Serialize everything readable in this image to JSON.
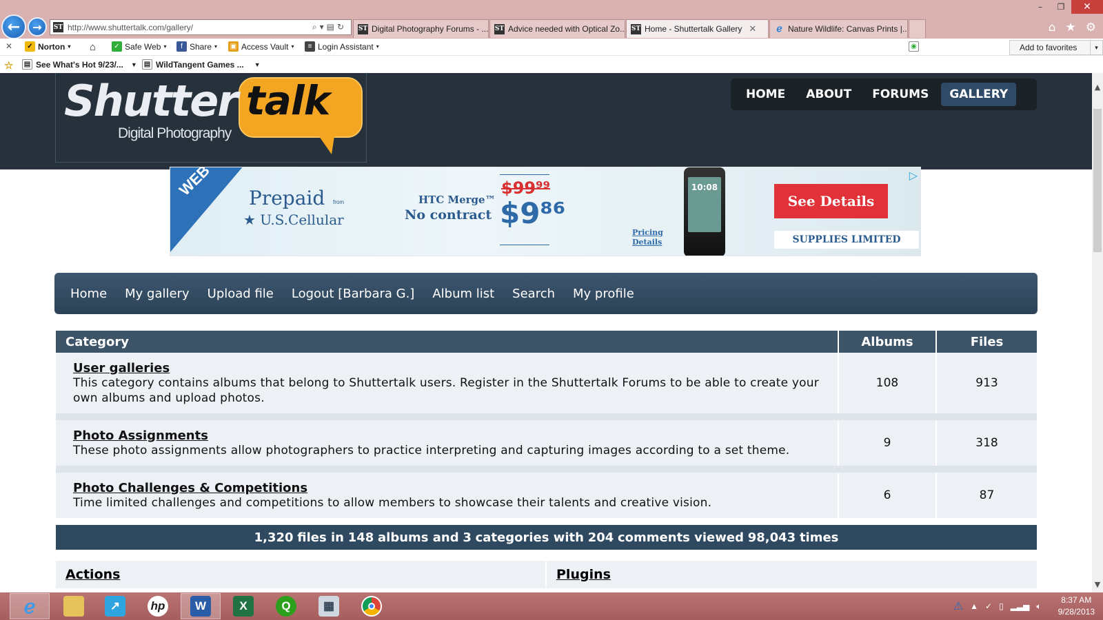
{
  "browser": {
    "url": "http://www.shuttertalk.com/gallery/",
    "tabs": [
      {
        "label": "Digital Photography Forums - ...",
        "active": false,
        "icon": "st-favicon"
      },
      {
        "label": "Advice needed with Optical Zo...",
        "active": false,
        "icon": "st-favicon"
      },
      {
        "label": "Home - Shuttertalk Gallery",
        "active": true,
        "icon": "st-favicon"
      },
      {
        "label": "Nature Wildlife: Canvas Prints |...",
        "active": false,
        "icon": "ie-favicon"
      }
    ],
    "favicon_text": "ST",
    "toolbar": {
      "norton": "Norton",
      "safe_web": "Safe Web",
      "share": "Share",
      "access_vault": "Access Vault",
      "login_assistant": "Login Assistant",
      "add_favorites": "Add to favorites"
    },
    "favorites_bar": {
      "item1": "See What's Hot 9/23/...",
      "item2": "WildTangent Games ..."
    }
  },
  "site": {
    "logo": {
      "word1": "Shutter",
      "word2": "talk",
      "tagline": "Digital Photography"
    },
    "top_nav": [
      {
        "label": "HOME",
        "active": false
      },
      {
        "label": "ABOUT",
        "active": false
      },
      {
        "label": "FORUMS",
        "active": false
      },
      {
        "label": "GALLERY",
        "active": true
      }
    ]
  },
  "ad": {
    "corner": "WEB ONLY",
    "prepaid": "Prepaid",
    "from": "from",
    "carrier": "U.S.Cellular",
    "model": "HTC Merge™",
    "contract": "No contract",
    "old_price": "$99⁹⁹",
    "new_price": "$9⁸⁶",
    "pricing_line1": "Pricing",
    "pricing_line2": "Details",
    "phone_time": "10:08",
    "cta": "See Details",
    "limited": "SUPPLIES LIMITED"
  },
  "gallery_nav": [
    "Home",
    "My gallery",
    "Upload file",
    "Logout [Barbara G.]",
    "Album list",
    "Search",
    "My profile"
  ],
  "table": {
    "headers": {
      "category": "Category",
      "albums": "Albums",
      "files": "Files"
    },
    "rows": [
      {
        "title": "User galleries",
        "desc": "This category contains albums that belong to Shuttertalk users. Register in the Shuttertalk Forums to be able to create your own albums and upload photos.",
        "albums": "108",
        "files": "913"
      },
      {
        "title": "Photo Assignments",
        "desc": "These photo assignments allow photographers to practice interpreting and capturing images according to a set theme.",
        "albums": "9",
        "files": "318"
      },
      {
        "title": "Photo Challenges & Competitions",
        "desc": "Time limited challenges and competitions to allow members to showcase their talents and creative vision.",
        "albums": "6",
        "files": "87"
      }
    ],
    "stats": {
      "files": "1,320",
      "t1": "files in",
      "albums": "148",
      "t2": "albums and",
      "categories": "3",
      "t3": "categories with",
      "comments": "204",
      "t4": "comments viewed",
      "views": "98,043",
      "t5": "times"
    },
    "footer": {
      "actions": "Actions",
      "plugins": "Plugins"
    }
  },
  "taskbar": {
    "clock_time": "8:37 AM",
    "clock_date": "9/28/2013",
    "apps": [
      "internet-explorer",
      "file-explorer",
      "launcher",
      "hp",
      "word",
      "excel",
      "quickbooks",
      "calculator",
      "chrome"
    ]
  },
  "colors": {
    "header_bg": "#26313b",
    "nav_bg": "#2c4256",
    "table_header": "#3c5368",
    "row_bg": "#edf1f5",
    "logo_orange": "#f4a623",
    "taskbar": "#a65d5d"
  }
}
